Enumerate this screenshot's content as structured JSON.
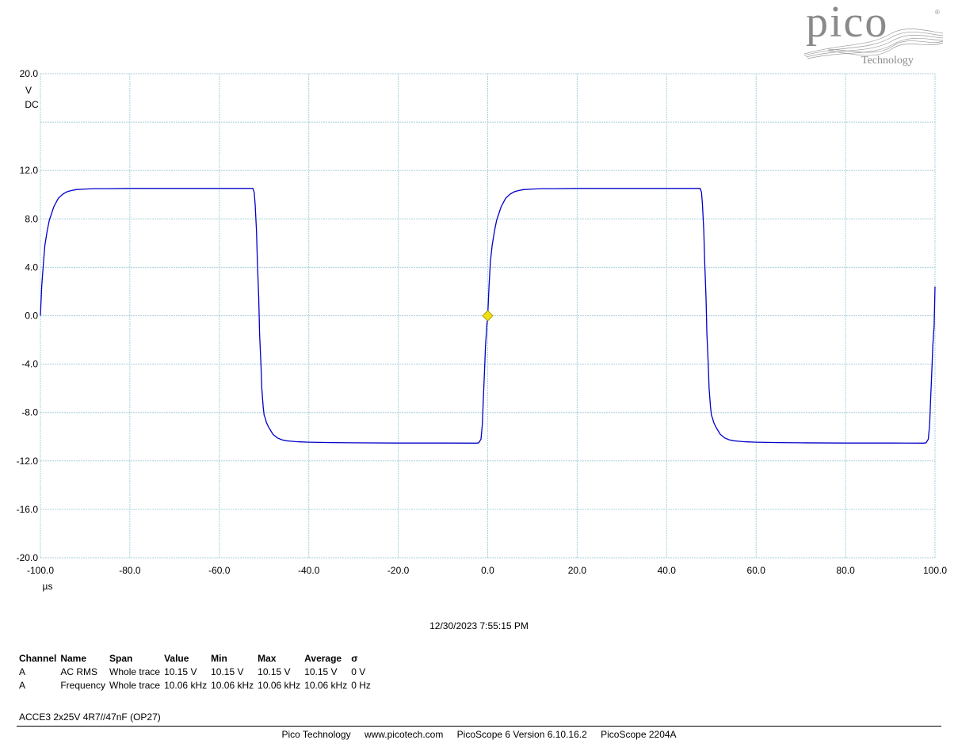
{
  "brand": {
    "logo_text": "pico",
    "logo_subtext": "Technology",
    "colors": {
      "logo_gray": "#8a8a8a",
      "trace": "#0000c8",
      "grid": "#a8d0dc",
      "trigger": "#f0e010"
    }
  },
  "chart_data": {
    "type": "line",
    "title": "",
    "xlabel": "µs",
    "ylabel": "V",
    "y_coupling": "DC",
    "xlim": [
      -100,
      100
    ],
    "ylim": [
      -20,
      20
    ],
    "x_ticks": [
      -100,
      -80,
      -60,
      -40,
      -20,
      0,
      20,
      40,
      60,
      80,
      100
    ],
    "x_tick_labels": [
      "-100.0",
      "-80.0",
      "-60.0",
      "-40.0",
      "-20.0",
      "0.0",
      "20.0",
      "40.0",
      "60.0",
      "80.0",
      "100.0"
    ],
    "y_ticks": [
      20,
      12,
      8,
      4,
      0,
      -4,
      -8,
      -12,
      -16,
      -20
    ],
    "y_tick_labels": [
      "20.0",
      "12.0",
      "8.0",
      "4.0",
      "0.0",
      "-4.0",
      "-8.0",
      "-12.0",
      "-16.0",
      "-20.0"
    ],
    "grid": true,
    "trigger_marker": {
      "x": 0,
      "y": 0
    },
    "series": [
      {
        "name": "A",
        "x": [
          -100,
          -99.7,
          -99.3,
          -99,
          -98.5,
          -98,
          -97,
          -96,
          -95,
          -94,
          -93,
          -92,
          -90,
          -88,
          -85,
          -80,
          -70,
          -60,
          -55,
          -52.5,
          -52.2,
          -52,
          -51.7,
          -51.5,
          -51.2,
          -51,
          -50.7,
          -50.5,
          -50.2,
          -50,
          -49.7,
          -49.5,
          -49,
          -48.5,
          -48,
          -47,
          -46,
          -45,
          -44,
          -43,
          -42,
          -40,
          -35,
          -30,
          -20,
          -10,
          -2.5,
          -2,
          -1.5,
          -1.2,
          -1,
          -0.7,
          -0.5,
          -0.2,
          0,
          0.3,
          0.6,
          1,
          1.5,
          2,
          3,
          4,
          5,
          6,
          7,
          8,
          10,
          12,
          15,
          20,
          30,
          40,
          45,
          47.5,
          47.8,
          48,
          48.3,
          48.5,
          48.8,
          49,
          49.3,
          49.5,
          49.8,
          50,
          50.3,
          50.5,
          51,
          51.5,
          52,
          53,
          54,
          55,
          56,
          57,
          58,
          60,
          65,
          70,
          80,
          90,
          97.5,
          98,
          98.5,
          98.8,
          99,
          99.3,
          99.5,
          99.8,
          100
        ],
        "y": [
          0,
          2.5,
          4.5,
          5.8,
          7,
          7.9,
          9,
          9.7,
          10.05,
          10.25,
          10.35,
          10.42,
          10.47,
          10.5,
          10.5,
          10.52,
          10.52,
          10.52,
          10.52,
          10.52,
          10.2,
          9.2,
          7,
          4.5,
          1.5,
          -1.5,
          -4,
          -6,
          -7.5,
          -8.2,
          -8.5,
          -8.8,
          -9.2,
          -9.5,
          -9.8,
          -10.1,
          -10.25,
          -10.33,
          -10.37,
          -10.4,
          -10.42,
          -10.45,
          -10.48,
          -10.5,
          -10.52,
          -10.52,
          -10.53,
          -10.5,
          -10.2,
          -9,
          -7,
          -4.5,
          -2.5,
          -0.8,
          0,
          2.5,
          4.5,
          5.8,
          7,
          7.9,
          9,
          9.7,
          10.05,
          10.25,
          10.35,
          10.42,
          10.47,
          10.5,
          10.5,
          10.52,
          10.52,
          10.52,
          10.52,
          10.52,
          10.2,
          9.2,
          7,
          4.5,
          1.5,
          -1.5,
          -4,
          -6,
          -7.5,
          -8.2,
          -8.5,
          -8.8,
          -9.2,
          -9.5,
          -9.8,
          -10.1,
          -10.25,
          -10.33,
          -10.37,
          -10.4,
          -10.42,
          -10.45,
          -10.48,
          -10.5,
          -10.52,
          -10.52,
          -10.53,
          -10.5,
          -10.2,
          -9,
          -7,
          -4.5,
          -2.5,
          -0.8,
          2.4
        ]
      }
    ]
  },
  "timestamp": "12/30/2023 7:55:15 PM",
  "measurements": {
    "headers": [
      "Channel",
      "Name",
      "Span",
      "Value",
      "Min",
      "Max",
      "Average",
      "σ"
    ],
    "rows": [
      [
        "A",
        "AC RMS",
        "Whole trace",
        "10.15 V",
        "10.15 V",
        "10.15 V",
        "10.15 V",
        "0 V"
      ],
      [
        "A",
        "Frequency",
        "Whole trace",
        "10.06 kHz",
        "10.06 kHz",
        "10.06 kHz",
        "10.06 kHz",
        "0 Hz"
      ]
    ]
  },
  "notes": "ACCE3 2x25V 4R7//47nF (OP27)",
  "footer": [
    "Pico Technology",
    "www.picotech.com",
    "PicoScope 6 Version 6.10.16.2",
    "PicoScope 2204A"
  ]
}
